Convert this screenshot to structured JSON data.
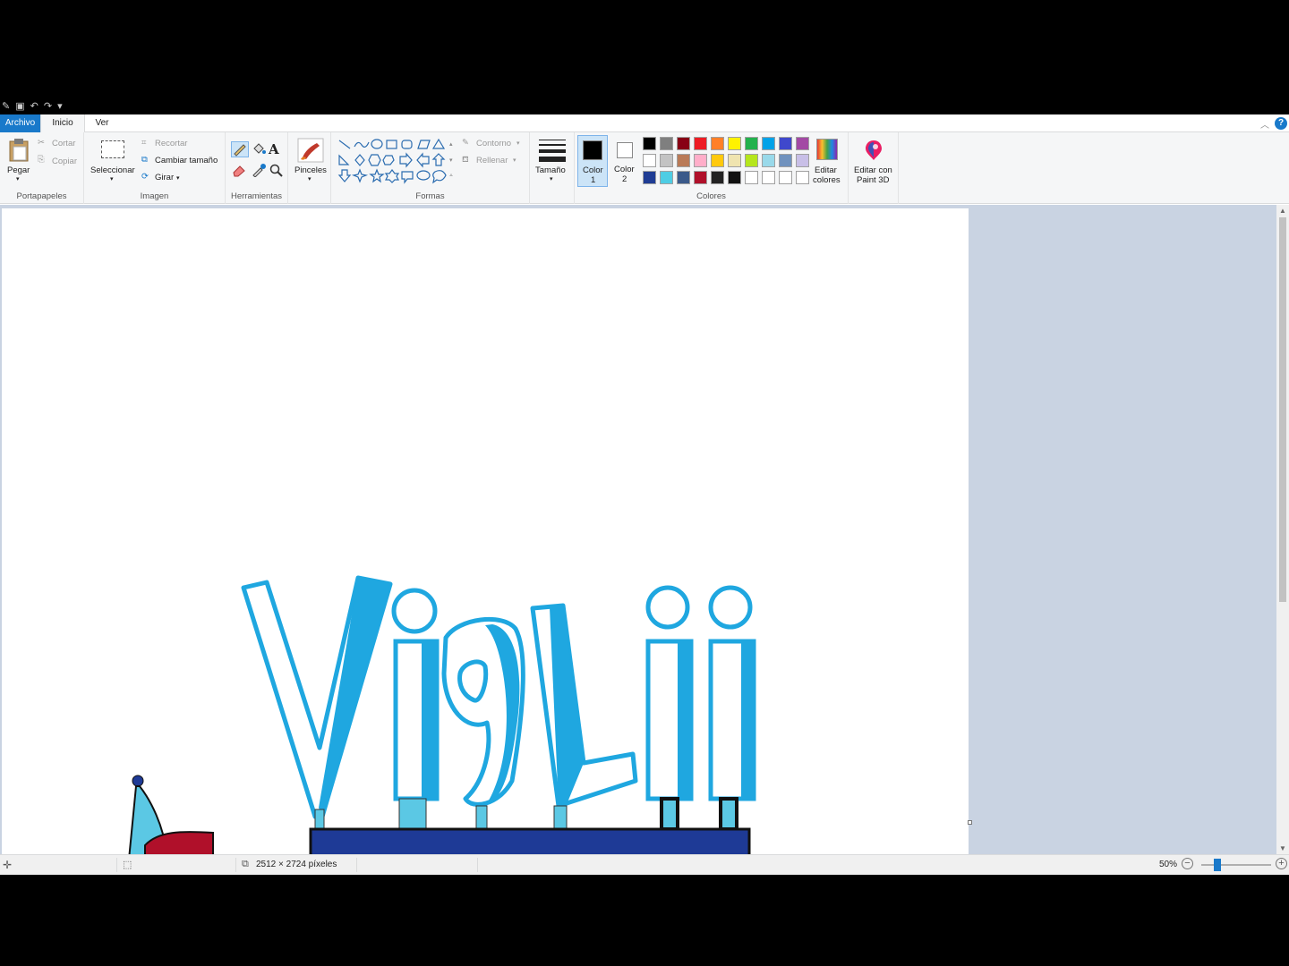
{
  "tabs": {
    "file": "Archivo",
    "home": "Inicio",
    "view": "Ver"
  },
  "help_label": "?",
  "clipboard": {
    "paste": "Pegar",
    "cut": "Cortar",
    "copy": "Copiar",
    "group": "Portapapeles"
  },
  "image": {
    "select": "Seleccionar",
    "crop": "Recortar",
    "resize": "Cambiar tamaño",
    "rotate": "Girar",
    "group": "Imagen"
  },
  "tools": {
    "group": "Herramientas"
  },
  "brushes": {
    "label": "Pinceles"
  },
  "shapes": {
    "outline": "Contorno",
    "fill": "Rellenar",
    "group": "Formas"
  },
  "size": {
    "label": "Tamaño"
  },
  "colors": {
    "color1_label": "Color",
    "color1_num": "1",
    "color2_label": "Color",
    "color2_num": "2",
    "edit_colors_line1": "Editar",
    "edit_colors_line2": "colores",
    "group": "Colores",
    "color1_value": "#000000",
    "color2_value": "#ffffff",
    "palette": [
      [
        "#000000",
        "#7f7f7f",
        "#880015",
        "#ed1c24",
        "#ff7f27",
        "#fff200",
        "#22b14c",
        "#00a2e8",
        "#3f48cc",
        "#a349a4"
      ],
      [
        "#ffffff",
        "#c3c3c3",
        "#b97a57",
        "#ffaec9",
        "#ffc90e",
        "#efe4b0",
        "#b5e61d",
        "#99d9ea",
        "#7092be",
        "#c8bfe7"
      ],
      [
        "#1f3c94",
        "#4ecde4",
        "#3b5a8a",
        "#b0102a",
        "#222222",
        "#111111",
        "#ffffff",
        "#ffffff",
        "#ffffff",
        "#ffffff"
      ]
    ]
  },
  "paint3d": {
    "line1": "Editar con",
    "line2": "Paint 3D"
  },
  "status": {
    "dimensions": "2512 × 2724 píxeles",
    "zoom": "50%"
  },
  "drawing": {
    "text": "Vi9Lii"
  }
}
